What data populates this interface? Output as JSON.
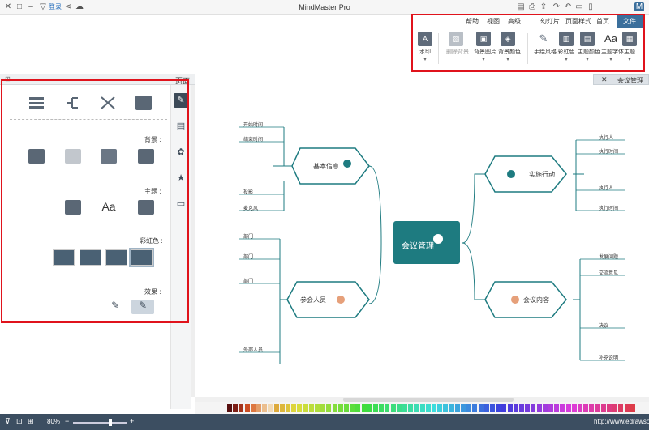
{
  "title_bar": {
    "title": "MindMaster Pro",
    "login_label": "登录"
  },
  "tabs": [
    {
      "label": "文件",
      "active": true
    },
    {
      "label": "首页",
      "active": false
    },
    {
      "label": "页面样式",
      "active": false
    },
    {
      "label": "幻灯片",
      "active": false
    },
    {
      "label": "高级",
      "active": false
    },
    {
      "label": "视图",
      "active": false
    },
    {
      "label": "帮助",
      "active": false
    }
  ],
  "ribbon": {
    "buttons": [
      {
        "label": "主题",
        "icon": "theme-icon",
        "glyph": "▦"
      },
      {
        "label": "主题字体",
        "icon": "font-icon",
        "glyph": "Aa"
      },
      {
        "label": "主题颜色",
        "icon": "theme-color-icon",
        "glyph": "▤"
      },
      {
        "label": "彩虹色",
        "icon": "rainbow-icon",
        "glyph": "▥"
      },
      {
        "label": "手绘风格",
        "icon": "handdrawn-icon",
        "glyph": "✎"
      },
      {
        "label": "背景颜色",
        "icon": "background-color-icon",
        "glyph": "◈"
      },
      {
        "label": "背景图片",
        "icon": "background-image-icon",
        "glyph": "▣"
      },
      {
        "label": "删除背景",
        "icon": "delete-background-icon",
        "glyph": "▨"
      },
      {
        "label": "水印",
        "icon": "watermark-icon",
        "glyph": "A"
      }
    ]
  },
  "left_panel": {
    "header": "页面",
    "sections": {
      "background": "背景 :",
      "theme": "主题 :",
      "rainbow": "彩虹色 :",
      "effect": "效果 :"
    }
  },
  "document_tab": {
    "label": "会议管理"
  },
  "mindmap": {
    "central": "会议管理",
    "branches": {
      "basic_info": "基本信息",
      "implement": "实施行动",
      "participants": "参会人员",
      "content": "会议内容"
    },
    "basic_info_items": [
      "时间",
      "开始时间",
      "结束时间",
      "地点",
      "会议室",
      "地点A",
      "地点B",
      "备注",
      "设备准备",
      "会场大小",
      "投影",
      "麦克风"
    ],
    "implement_items": [
      "执行人",
      "执行时间",
      "执行方式",
      "项目1",
      "执行人",
      "执行时间",
      "项目2",
      "执行人",
      "执行时间",
      "项目3"
    ],
    "participant_items": [
      "内部人员",
      "负责",
      "部门",
      "公司",
      "部门",
      "职务",
      "部门",
      "职务",
      "部门",
      "职务",
      "外部人员"
    ],
    "content_items": [
      "议题",
      "发展问题",
      "问题分析",
      "交流意见",
      "议程",
      "环节一",
      "环节二",
      "环节三",
      "决议",
      "解决方案",
      "补充说明"
    ]
  },
  "status_bar": {
    "url": "http://www.edrawsoft.cn",
    "zoom": "80%"
  },
  "colors": {
    "accent": "#3b6f9c",
    "central_node": "#1e7b80",
    "status_bar": "#3c4e61",
    "highlight_box": "#e0131c"
  }
}
